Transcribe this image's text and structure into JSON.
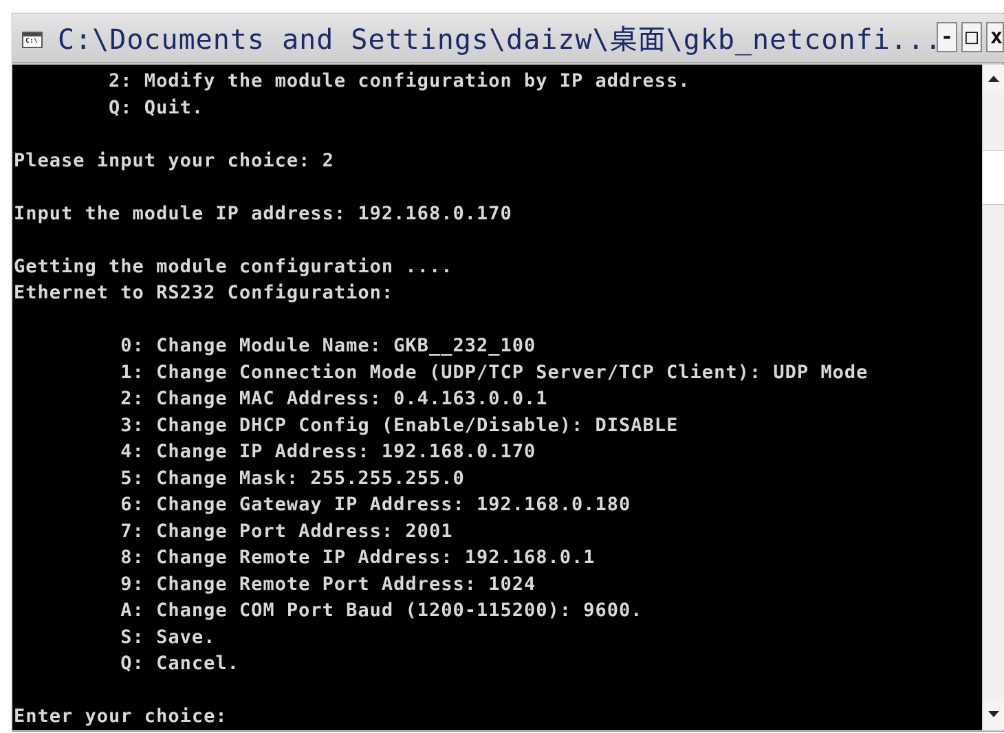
{
  "window": {
    "title": "C:\\Documents and Settings\\daizw\\桌面\\gkb_netconfi...",
    "icon": "console-icon",
    "icon_text": "C:\\",
    "minimize_label": "-",
    "maximize_label": "□",
    "close_label": "x"
  },
  "console": {
    "lines": [
      "        2: Modify the module configuration by IP address.",
      "        Q: Quit.",
      "",
      "Please input your choice: 2",
      "",
      "Input the module IP address: 192.168.0.170",
      "",
      "Getting the module configuration ....",
      "Ethernet to RS232 Configuration:",
      "",
      "         0: Change Module Name: GKB__232_100",
      "         1: Change Connection Mode (UDP/TCP Server/TCP Client): UDP Mode",
      "         2: Change MAC Address: 0.4.163.0.0.1",
      "         3: Change DHCP Config (Enable/Disable): DISABLE",
      "         4: Change IP Address: 192.168.0.170",
      "         5: Change Mask: 255.255.255.0",
      "         6: Change Gateway IP Address: 192.168.0.180",
      "         7: Change Port Address: 2001",
      "         8: Change Remote IP Address: 192.168.0.1",
      "         9: Change Remote Port Address: 1024",
      "         A: Change COM Port Baud (1200-115200): 9600.",
      "         S: Save.",
      "         Q: Cancel.",
      "",
      "Enter your choice:"
    ]
  },
  "scrollbar": {
    "up_icon": "scroll-up-arrow-icon",
    "down_icon": "scroll-down-arrow-icon"
  },
  "colors": {
    "console_bg": "#000000",
    "console_text": "#d8d8d8",
    "title_text": "#1c2a6a"
  }
}
